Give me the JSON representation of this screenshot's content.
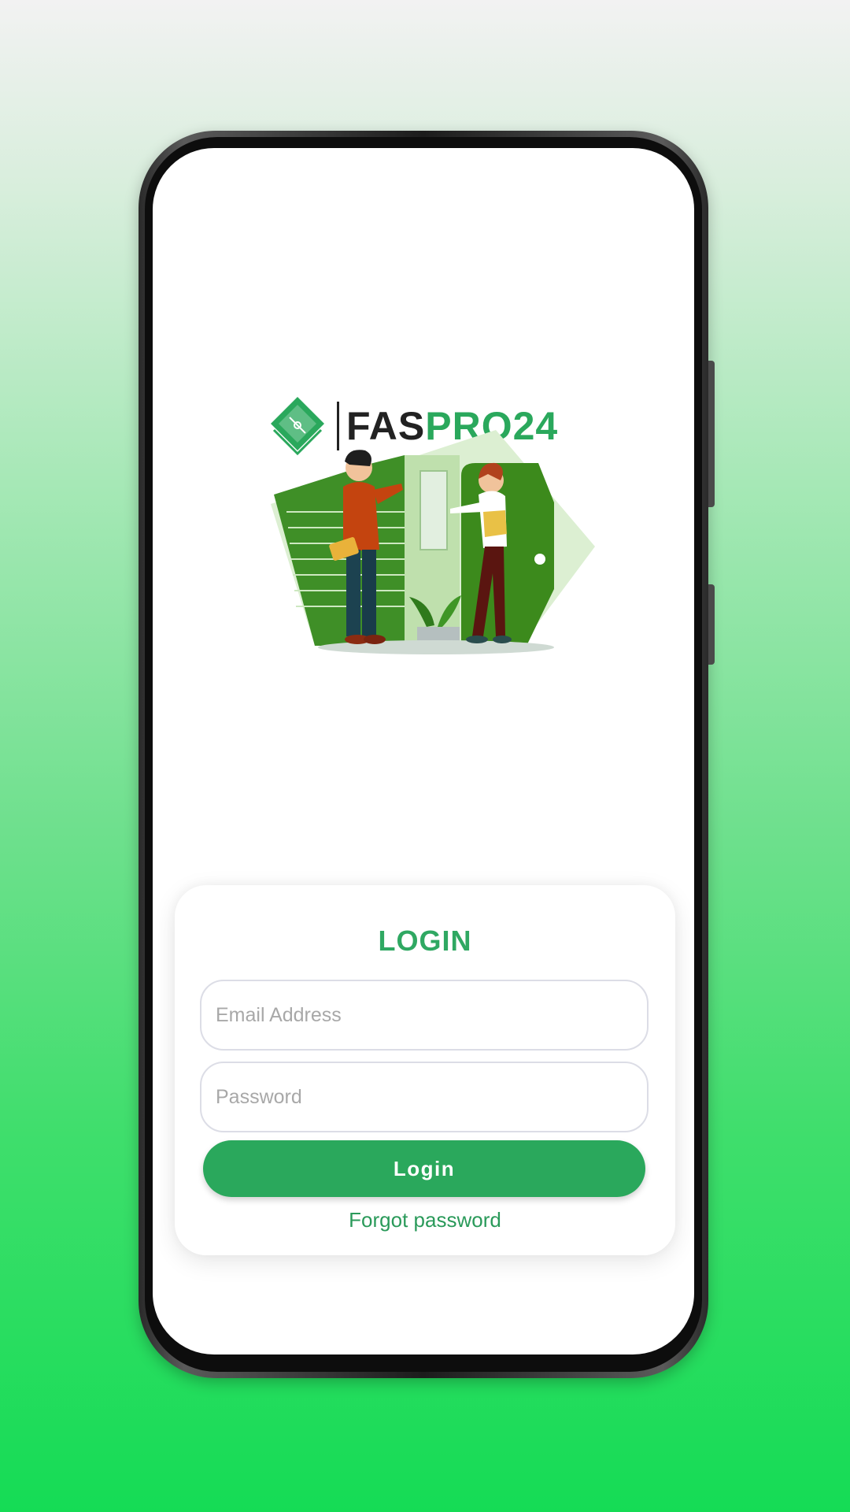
{
  "app": {
    "brand_part1": "FAS",
    "brand_part2": "PRO24",
    "brand_dark_color": "#222222",
    "brand_green_color": "#2aa85c"
  },
  "login": {
    "title": "LOGIN",
    "email_placeholder": "Email Address",
    "email_value": "",
    "password_placeholder": "Password",
    "password_value": "",
    "submit_label": "Login",
    "forgot_label": "Forgot password"
  },
  "icons": {
    "logo": "house-diamond-logo-icon",
    "illustration": "real-estate-agent-handing-keys"
  }
}
